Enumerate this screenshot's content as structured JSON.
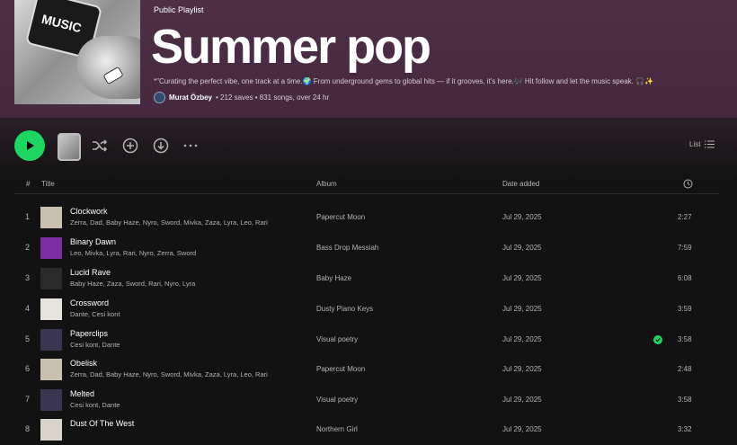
{
  "header": {
    "type_label": "Public Playlist",
    "title": "Summer pop",
    "description": "*\"Curating the perfect vibe, one track at a time.🌍 From underground gems to global hits — if it grooves, it's here.🎶 Hit follow and let the music speak. 🎧✨",
    "owner": "Murat Özbey",
    "stats": "• 212 saves • 831 songs, over 24 hr",
    "cover_text": "MUSIC"
  },
  "controls": {
    "view_label": "List"
  },
  "table": {
    "headers": {
      "index": "#",
      "title": "Title",
      "album": "Album",
      "date_added": "Date added"
    },
    "rows": [
      {
        "index": "1",
        "title": "Clockwork",
        "artists": "Zerra, Dad, Baby Haze, Nyro, Sword, Mivka, Zaza, Lyra, Leo, Rari",
        "album": "Papercut Moon",
        "date": "Jul 29, 2025",
        "duration": "2:27",
        "saved": false,
        "thumb": "#c9bfae"
      },
      {
        "index": "2",
        "title": "Binary Dawn",
        "artists": "Leo, Mivka, Lyra, Rari, Nyro, Zerra, Sword",
        "album": "Bass Drop Messiah",
        "date": "Jul 29, 2025",
        "duration": "7:59",
        "saved": false,
        "thumb": "#7d2ea3"
      },
      {
        "index": "3",
        "title": "Lucid Rave",
        "artists": "Baby Haze, Zaza, Sword, Rari, Nyro, Lyra",
        "album": "Baby Haze",
        "date": "Jul 29, 2025",
        "duration": "6:08",
        "saved": false,
        "thumb": "#2a2a2a"
      },
      {
        "index": "4",
        "title": "Crossword",
        "artists": "Dante, Cesi kont",
        "album": "Dusty Piano Keys",
        "date": "Jul 29, 2025",
        "duration": "3:59",
        "saved": false,
        "thumb": "#e6e2dc"
      },
      {
        "index": "5",
        "title": "Paperclips",
        "artists": "Cesi kont, Dante",
        "album": "Visual poetry",
        "date": "Jul 29, 2025",
        "duration": "3:58",
        "saved": true,
        "thumb": "#3a3550"
      },
      {
        "index": "6",
        "title": "Obelisk",
        "artists": "Zerra, Dad, Baby Haze, Nyro, Sword, Mivka, Zaza, Lyra, Leo, Rari",
        "album": "Papercut Moon",
        "date": "Jul 29, 2025",
        "duration": "2:48",
        "saved": false,
        "thumb": "#c9bfae"
      },
      {
        "index": "7",
        "title": "Melted",
        "artists": "Cesi kont, Dante",
        "album": "Visual poetry",
        "date": "Jul 29, 2025",
        "duration": "3:58",
        "saved": false,
        "thumb": "#3a3550"
      },
      {
        "index": "8",
        "title": "Dust Of The West",
        "artists": "",
        "album": "Northern Girl",
        "date": "Jul 29, 2025",
        "duration": "3:32",
        "saved": false,
        "thumb": "#d8d4cc"
      }
    ]
  },
  "colors": {
    "accent": "#1ed760",
    "header_bg": "#4e2f45",
    "page_bg": "#121212"
  }
}
